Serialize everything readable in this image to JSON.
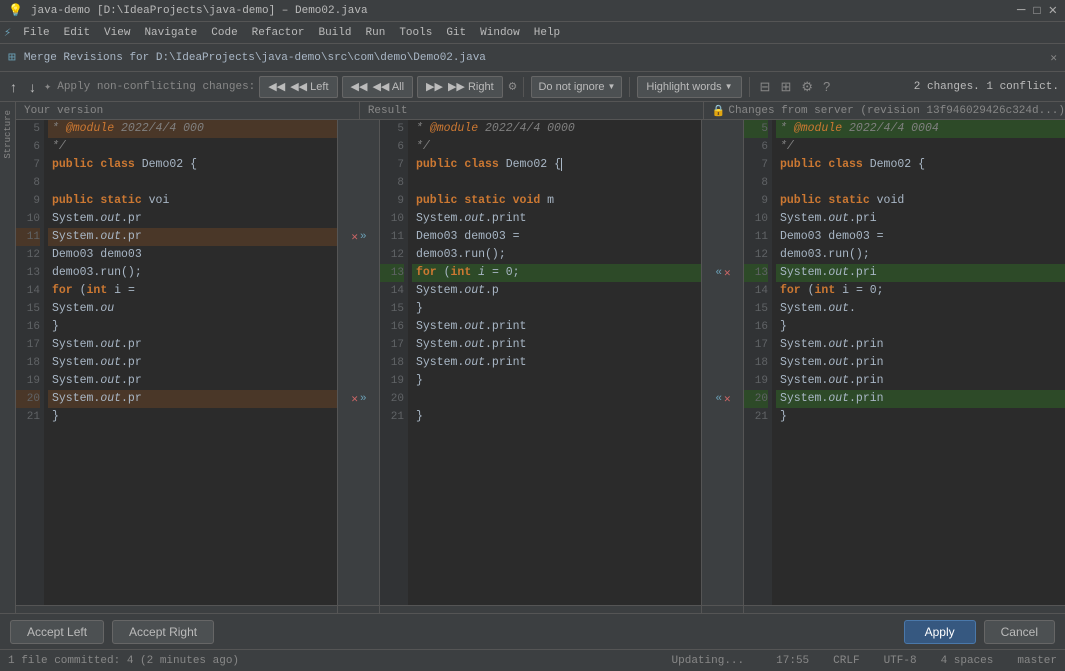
{
  "titleBar": {
    "appName": "IntelliJ IDEA",
    "fileLabel": "java-demo [D:\\IdeaProjects\\java-demo] – Demo02.java"
  },
  "menuBar": {
    "items": [
      "File",
      "Edit",
      "View",
      "Navigate",
      "Code",
      "Refactor",
      "Build",
      "Run",
      "Tools",
      "Git",
      "Window",
      "Help"
    ]
  },
  "mergePath": {
    "label": "Merge Revisions for D:\\IdeaProjects\\java-demo\\src\\com\\demo\\Demo02.java"
  },
  "toolbar": {
    "arrowUp": "↑",
    "arrowDown": "↓",
    "applyNonConflicting": "Apply non-conflicting changes:",
    "leftLabel": "◀◀ Left",
    "allLabel": "◀◀ All",
    "rightLabel": "▶▶ Right",
    "gearLabel": "⚙",
    "doNotIgnoreLabel": "Do not ignore",
    "highlightWordsLabel": "Highlight words",
    "collapseIcon": "⊟",
    "splitIcon": "⊞",
    "settingsIcon": "⚙",
    "helpIcon": "?",
    "conflictCount": "2 changes. 1 conflict."
  },
  "panels": {
    "left": {
      "header": "Your version",
      "scrollbarTop": 0
    },
    "middle": {
      "header": "Result",
      "scrollbarTop": 0
    },
    "right": {
      "header": "Changes from server (revision 13f946029426c324d...)",
      "scrollbarTop": 0
    }
  },
  "codeLines": {
    "left": [
      {
        "num": "5",
        "text": "* @module 2022/4/4 000",
        "cls": "comment conflict-yours"
      },
      {
        "num": "6",
        "text": "*/",
        "cls": "comment bg-normal"
      },
      {
        "num": "7",
        "text": "public class Demo02 {",
        "cls": "bg-normal"
      },
      {
        "num": "8",
        "text": "",
        "cls": "bg-normal"
      },
      {
        "num": "9",
        "text": "    public static voi",
        "cls": "bg-normal"
      },
      {
        "num": "10",
        "text": "        System.out.pr",
        "cls": "bg-normal"
      },
      {
        "num": "11",
        "text": "        System.out.pr",
        "cls": "conflict-yours"
      },
      {
        "num": "12",
        "text": "        Demo03 demo03",
        "cls": "bg-normal"
      },
      {
        "num": "13",
        "text": "        demo03.run();",
        "cls": "bg-normal"
      },
      {
        "num": "14",
        "text": "        for (int i =",
        "cls": "bg-normal"
      },
      {
        "num": "15",
        "text": "            System.ou",
        "cls": "bg-normal"
      },
      {
        "num": "16",
        "text": "    }",
        "cls": "bg-normal"
      },
      {
        "num": "17",
        "text": "    System.out.pr",
        "cls": "bg-normal"
      },
      {
        "num": "18",
        "text": "    System.out.pr",
        "cls": "bg-normal"
      },
      {
        "num": "19",
        "text": "    System.out.pr",
        "cls": "bg-normal"
      },
      {
        "num": "20",
        "text": "    System.out.pr",
        "cls": "conflict-yours"
      },
      {
        "num": "21",
        "text": "}",
        "cls": "bg-normal"
      }
    ],
    "middle": [
      {
        "num": "5",
        "text": "* @module 2022/4/4 0000",
        "cls": "comment bg-normal"
      },
      {
        "num": "6",
        "text": "*/",
        "cls": "comment bg-normal"
      },
      {
        "num": "7",
        "text": "public class Demo02 {",
        "cls": "bg-normal"
      },
      {
        "num": "8",
        "text": "",
        "cls": "bg-normal"
      },
      {
        "num": "9",
        "text": "    public static void m",
        "cls": "bg-normal"
      },
      {
        "num": "10",
        "text": "        System.out.print",
        "cls": "bg-normal"
      },
      {
        "num": "11",
        "text": "        Demo03 demo03 =",
        "cls": "bg-normal"
      },
      {
        "num": "12",
        "text": "        demo03.run();",
        "cls": "bg-normal"
      },
      {
        "num": "13",
        "text": "        for (int i = 0;",
        "cls": "conflict-theirs"
      },
      {
        "num": "14",
        "text": "            System.out.p",
        "cls": "bg-normal"
      },
      {
        "num": "15",
        "text": "        }",
        "cls": "bg-normal"
      },
      {
        "num": "16",
        "text": "    System.out.print",
        "cls": "bg-normal"
      },
      {
        "num": "17",
        "text": "    System.out.print",
        "cls": "bg-normal"
      },
      {
        "num": "18",
        "text": "    System.out.print",
        "cls": "bg-normal"
      },
      {
        "num": "19",
        "text": "    }",
        "cls": "bg-normal"
      },
      {
        "num": "20",
        "text": "",
        "cls": "bg-normal"
      },
      {
        "num": "21",
        "text": "}",
        "cls": "bg-normal"
      }
    ],
    "right": [
      {
        "num": "5",
        "text": "* @module 2022/4/4 0004",
        "cls": "comment conflict-theirs"
      },
      {
        "num": "6",
        "text": "*/",
        "cls": "comment bg-normal"
      },
      {
        "num": "7",
        "text": "public class Demo02 {",
        "cls": "bg-normal"
      },
      {
        "num": "8",
        "text": "",
        "cls": "bg-normal"
      },
      {
        "num": "9",
        "text": "    public static void",
        "cls": "bg-normal"
      },
      {
        "num": "10",
        "text": "        System.out.pri",
        "cls": "bg-normal"
      },
      {
        "num": "11",
        "text": "        Demo03 demo03 =",
        "cls": "bg-normal"
      },
      {
        "num": "12",
        "text": "        demo03.run();",
        "cls": "bg-normal"
      },
      {
        "num": "13",
        "text": "        System.out.pri",
        "cls": "conflict-theirs"
      },
      {
        "num": "14",
        "text": "        for (int i = 0;",
        "cls": "bg-normal"
      },
      {
        "num": "15",
        "text": "            System.out.",
        "cls": "bg-normal"
      },
      {
        "num": "16",
        "text": "    }",
        "cls": "bg-normal"
      },
      {
        "num": "17",
        "text": "    System.out.prin",
        "cls": "bg-normal"
      },
      {
        "num": "18",
        "text": "    System.out.prin",
        "cls": "bg-normal"
      },
      {
        "num": "19",
        "text": "    System.out.prin",
        "cls": "bg-normal"
      },
      {
        "num": "20",
        "text": "    System.out.prin",
        "cls": "conflict-theirs"
      },
      {
        "num": "21",
        "text": "}",
        "cls": "bg-normal"
      }
    ]
  },
  "gutterLeft": {
    "rows": [
      {
        "row": 11,
        "controls": [
          "X",
          ">>"
        ]
      },
      {
        "row": 20,
        "controls": [
          "X",
          ">>"
        ]
      }
    ]
  },
  "gutterRight": {
    "rows": [
      {
        "row": 13,
        "controls": [
          "<<",
          "X"
        ]
      },
      {
        "row": 20,
        "controls": [
          "<<",
          "X"
        ]
      }
    ]
  },
  "bottomBar": {
    "acceptLeft": "Accept Left",
    "acceptRight": "Accept Right",
    "apply": "Apply",
    "cancel": "Cancel"
  },
  "statusBar": {
    "commitText": "1 file committed: 4 (2 minutes ago)",
    "updatingText": "Updating...",
    "time": "17:55",
    "lineEnding": "CRLF",
    "encoding": "UTF-8",
    "indent": "4 spaces",
    "branch": "master"
  }
}
